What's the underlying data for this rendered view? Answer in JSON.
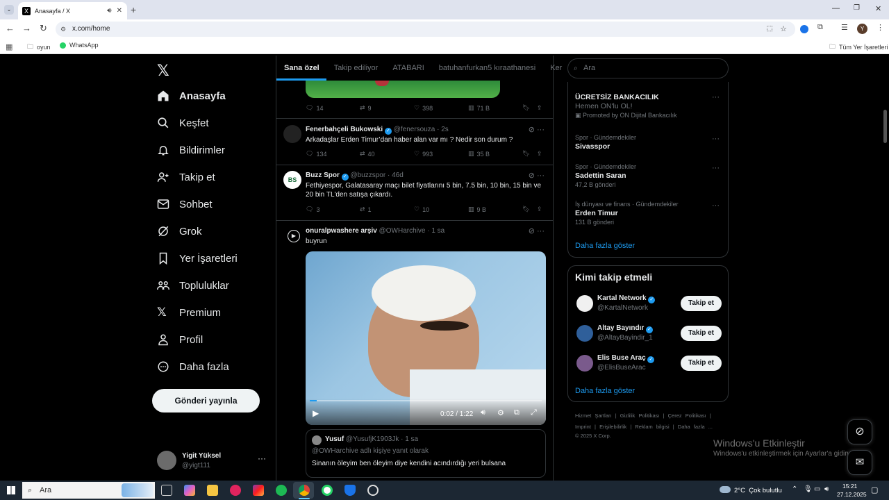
{
  "browser": {
    "tab_title": "Anasayfa / X",
    "url": "x.com/home",
    "bookmarks": [
      "oyun",
      "WhatsApp"
    ],
    "all_bookmarks": "Tüm Yer İşaretleri",
    "profile_initial": "Y"
  },
  "nav": {
    "items": [
      "Anasayfa",
      "Keşfet",
      "Bildirimler",
      "Takip et",
      "Sohbet",
      "Grok",
      "Yer İşaretleri",
      "Topluluklar",
      "Premium",
      "Profil",
      "Daha fazla"
    ],
    "post_button": "Gönderi yayınla",
    "user_name": "Yigit Yüksel",
    "user_handle": "@yigt111"
  },
  "tabs": [
    "Sana özel",
    "Takip ediliyor",
    "ATABARI",
    "batuhanfurkan5 kıraathanesi",
    "Ker"
  ],
  "posts": [
    {
      "actions": {
        "replies": "14",
        "reposts": "9",
        "likes": "398",
        "views": "71 B"
      }
    },
    {
      "name": "Fenerbahçeli Bukowski",
      "handle": "@fenersouza · 2s",
      "text": "Arkadaşlar Erden Timur’dan haber alan var mı ? Nedir son durum ?",
      "actions": {
        "replies": "134",
        "reposts": "40",
        "likes": "993",
        "views": "35 B"
      }
    },
    {
      "name": "Buzz Spor",
      "handle": "@buzzspor · 46d",
      "text": "Fethiyespor, Galatasaray maçı bilet fiyatlarını 5 bin, 7.5 bin, 10 bin, 15 bin ve 20 bin TL'den satışa çıkardı.",
      "avatar_text": "BS",
      "actions": {
        "replies": "3",
        "reposts": "1",
        "likes": "10",
        "views": "9 B"
      }
    },
    {
      "name": "onuralpwashere arşiv",
      "handle": "@OWHarchive · 1 sa",
      "text": "buyrun",
      "video_time": "0:02 / 1:22"
    }
  ],
  "reply": {
    "name": "Yusuf",
    "handle": "@YusufjK1903Jk · 1 sa",
    "context": "@OWHarchive adlı kişiye yanıt olarak",
    "text": "Sinanın öleyim ben öleyim diye kendini acındırdığı yeri bulsana"
  },
  "right": {
    "search_placeholder": "Ara",
    "ad": {
      "title": "ÜCRETSİZ BANKACILIK",
      "sub": "Hemen ON'lu OL!",
      "promo": "Promoted by ON Dijital Bankacılık"
    },
    "trends": [
      {
        "cat": "Spor · Gündemdekiler",
        "name": "Sivasspor",
        "count": ""
      },
      {
        "cat": "Spor · Gündemdekiler",
        "name": "Sadettin Saran",
        "count": "47,2 B gönderi"
      },
      {
        "cat": "İş dünyası ve finans · Gündemdekiler",
        "name": "Erden Timur",
        "count": "131 B gönderi"
      }
    ],
    "show_more": "Daha fazla göster",
    "who_title": "Kimi takip etmeli",
    "who": [
      {
        "name": "Kartal Network",
        "handle": "@KartalNetwork"
      },
      {
        "name": "Altay Bayındır",
        "handle": "@AltayBayindir_1"
      },
      {
        "name": "Elis Buse Araç",
        "handle": "@ElisBuseArac"
      }
    ],
    "follow": "Takip et",
    "footer1": [
      "Hizmet Şartları",
      "|",
      "Gizlilik Politikası",
      "|",
      "Çerez Politikası",
      "|"
    ],
    "footer2": [
      "Imprint",
      "|",
      "Erişilebilirlik",
      "|",
      "Reklam bilgisi",
      "|",
      "Daha fazla ..."
    ],
    "copyright": "© 2025 X Corp."
  },
  "activate": {
    "title": "Windows'u Etkinleştir",
    "sub": "Windows'u etkinleştirmek için Ayarlar'a gidin."
  },
  "taskbar": {
    "search": "Ara",
    "weather": "2°C  Çok bulutlu",
    "time": "15:21",
    "date": "27.12.2025"
  }
}
